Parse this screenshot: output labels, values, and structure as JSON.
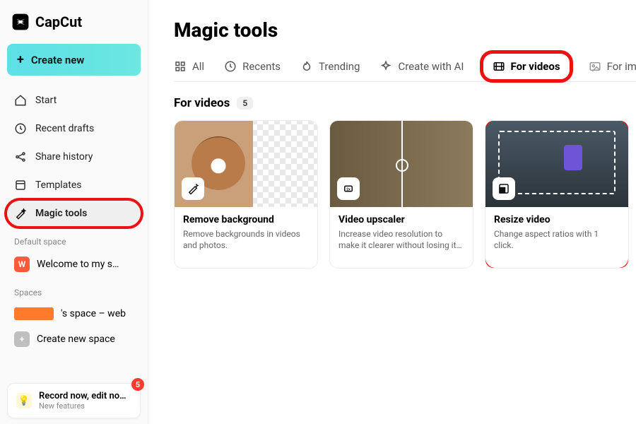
{
  "brand": {
    "name": "CapCut"
  },
  "sidebar": {
    "create_label": "Create new",
    "items": [
      {
        "label": "Start"
      },
      {
        "label": "Recent drafts"
      },
      {
        "label": "Share history"
      },
      {
        "label": "Templates"
      },
      {
        "label": "Magic tools"
      }
    ],
    "default_space_lbl": "Default space",
    "default_space": {
      "initial": "W",
      "name": "Welcome to my s…"
    },
    "spaces_lbl": "Spaces",
    "space_item": {
      "suffix": "'s space – web"
    },
    "create_space": "Create new space",
    "record": {
      "title": "Record now, edit no…",
      "sub": "New features",
      "count": "5"
    }
  },
  "page": {
    "title": "Magic tools"
  },
  "tabs": [
    {
      "label": "All"
    },
    {
      "label": "Recents"
    },
    {
      "label": "Trending"
    },
    {
      "label": "Create with AI"
    },
    {
      "label": "For videos"
    },
    {
      "label": "For images"
    }
  ],
  "section": {
    "title": "For videos",
    "count": "5"
  },
  "cards": [
    {
      "title": "Remove background",
      "desc": "Remove backgrounds in videos and photos."
    },
    {
      "title": "Video upscaler",
      "desc": "Increase video resolution to make it clearer without losing it…"
    },
    {
      "title": "Resize video",
      "desc": "Change aspect ratios with 1 click."
    }
  ]
}
